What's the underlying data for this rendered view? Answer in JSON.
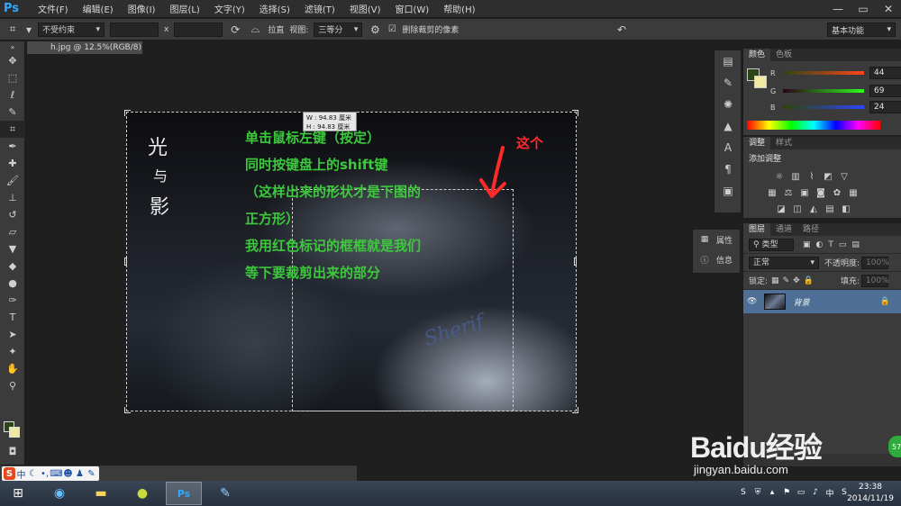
{
  "app": {
    "logo": "Ps"
  },
  "menu": [
    "文件(F)",
    "编辑(E)",
    "图像(I)",
    "图层(L)",
    "文字(Y)",
    "选择(S)",
    "滤镜(T)",
    "视图(V)",
    "窗口(W)",
    "帮助(H)"
  ],
  "window_controls": {
    "minimize": "—",
    "restore": "▭",
    "close": "✕"
  },
  "options": {
    "ratio": "不受约束",
    "times": "x",
    "straighten": "拉直",
    "view_label": "视图:",
    "view_value": "三等分",
    "delete_cropped": "删除裁剪的像素",
    "workspace": "基本功能"
  },
  "document": {
    "tab": "h.jpg @ 12.5%(RGB/8)"
  },
  "crop_tip": {
    "w": "W : 94.83 厘米",
    "h": "H : 94.83 厘米"
  },
  "image_text": {
    "vertical": [
      "光",
      "与",
      "影"
    ],
    "green_lines": [
      "单击鼠标左键（按定）",
      "同时按键盘上的shift键",
      "（这样出来的形状才是下图的",
      "正方形）",
      "我用红色标记的框框就是我们",
      "等下要裁剪出来的部分"
    ],
    "red_note": "这个",
    "watermark": "Sherif"
  },
  "color_panel": {
    "tabs": [
      "颜色",
      "色板"
    ],
    "sliders": [
      {
        "label": "R",
        "value": "44"
      },
      {
        "label": "G",
        "value": "69"
      },
      {
        "label": "B",
        "value": "24"
      }
    ],
    "colors": {
      "foreground": "#2d4618",
      "background": "#f0eaa0"
    }
  },
  "adjust_panel": {
    "tabs": [
      "调整",
      "样式"
    ],
    "title": "添加调整"
  },
  "props_dock": {
    "properties": "属性",
    "info": "信息"
  },
  "layers_panel": {
    "tabs": [
      "图层",
      "通道",
      "路径"
    ],
    "filter": "类型",
    "blend_mode": "正常",
    "opacity_label": "不透明度:",
    "opacity": "100%",
    "lock_label": "锁定:",
    "fill_label": "填充:",
    "fill": "100%",
    "layer_name": "背景"
  },
  "baidu": {
    "logo": "Baidu经验",
    "url": "jingyan.baidu.com",
    "badge": "57"
  },
  "taskbar": {
    "time": "23:38",
    "date": "2014/11/19",
    "ime_logo": "S",
    "ime_lang": "中"
  }
}
